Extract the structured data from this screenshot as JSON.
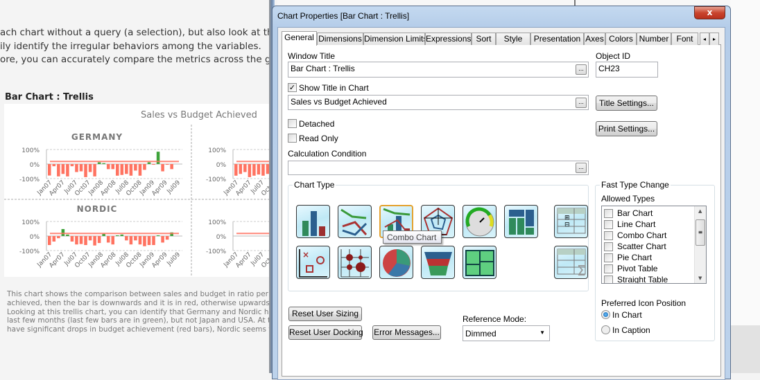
{
  "background": {
    "intro_lines": [
      "ach chart without a query (a selection), but also look at the bigg",
      "ily identify the irregular behaviors among the variables.",
      "ore, you can accurately compare the metrics across the grid."
    ],
    "object_caption": "Bar Chart : Trellis",
    "description_lines": [
      "This chart shows the comparison between sales and budget in ratio per month.",
      "achieved, then the bar is downwards and it is in red, otherwise upwards and in",
      "Looking at this trellis chart, you can identify that Germany and Nordic have bee",
      "last few months (last few bars are in green), but not Japan and USA.  At the sa",
      "have significant drops in budget achievement (red bars), Nordic seems to be co"
    ]
  },
  "chart_data": {
    "type": "bar",
    "title": "Sales vs Budget Achieved",
    "y_ticks": [
      "100%",
      "0%",
      "-100%"
    ],
    "ylim": [
      -100,
      100
    ],
    "target_line": 18,
    "x_tick_labels": [
      "Jan07",
      "Apr07",
      "Jul07",
      "Oct07",
      "Jan08",
      "Apr08",
      "Jul08",
      "Oct08",
      "Jan09",
      "Apr09",
      "Jul09"
    ],
    "colors": {
      "negative": "#ff7361",
      "positive": "#3ea33a",
      "target": "#ff7361"
    },
    "panes": [
      {
        "name": "GERMANY",
        "values": [
          -79,
          -15,
          -85,
          -68,
          -85,
          -15,
          -55,
          -50,
          -90,
          -55,
          -85,
          12,
          6,
          -35,
          -35,
          -80,
          -75,
          -68,
          -80,
          -45,
          -80,
          -40,
          12,
          -5,
          85,
          -50,
          -5,
          -35
        ]
      },
      {
        "name": "",
        "values": [
          -80,
          -68,
          -55,
          -90,
          -80,
          -72,
          -80,
          -68,
          -68
        ]
      },
      {
        "name": "NORDIC",
        "values": [
          -62,
          -38,
          -15,
          48,
          10,
          -38,
          -58,
          -55,
          -62,
          -30,
          -65,
          -48,
          15,
          -45,
          -58,
          5,
          10,
          -30,
          -58,
          -30,
          -58,
          -70,
          -62,
          -62,
          5,
          -45,
          -25,
          25
        ]
      },
      {
        "name": "",
        "values": []
      }
    ]
  },
  "dialog": {
    "title": "Chart Properties [Bar Chart : Trellis]",
    "close_label": "x",
    "tabs": [
      "General",
      "Dimensions",
      "Dimension Limits",
      "Expressions",
      "Sort",
      "Style",
      "Presentation",
      "Axes",
      "Colors",
      "Number",
      "Font"
    ],
    "window_title_label": "Window Title",
    "window_title_value": "Bar Chart : Trellis",
    "object_id_label": "Object ID",
    "object_id_value": "CH23",
    "show_title_label": "Show Title in Chart",
    "show_title_checked": true,
    "title_value": "Sales vs Budget Achieved",
    "title_settings": "Title Settings...",
    "detached_label": "Detached",
    "read_only_label": "Read Only",
    "print_settings": "Print Settings...",
    "calc_condition_label": "Calculation Condition",
    "calc_condition_value": "",
    "ellipsis": "...",
    "chart_type_label": "Chart Type",
    "chart_types": [
      "bar-chart",
      "line-chart",
      "combo-chart",
      "radar-chart",
      "gauge-chart",
      "block-chart",
      "pivot-table",
      "scatter-chart",
      "grid-chart",
      "pie-chart",
      "funnel-chart",
      "mekko-chart",
      "straight-table"
    ],
    "tooltip": "Combo Chart",
    "fast_type_label": "Fast Type Change",
    "allowed_types_label": "Allowed Types",
    "allowed_types": [
      "Bar Chart",
      "Line Chart",
      "Combo Chart",
      "Scatter Chart",
      "Pie Chart",
      "Pivot Table",
      "Straight Table"
    ],
    "icon_position_label": "Preferred Icon Position",
    "icon_positions": [
      "In Chart",
      "In Caption"
    ],
    "icon_position_selected": "In Chart",
    "reset_sizing": "Reset User Sizing",
    "reset_docking": "Reset User Docking",
    "error_messages": "Error Messages...",
    "reference_mode_label": "Reference Mode:",
    "reference_mode_value": "Dimmed"
  }
}
